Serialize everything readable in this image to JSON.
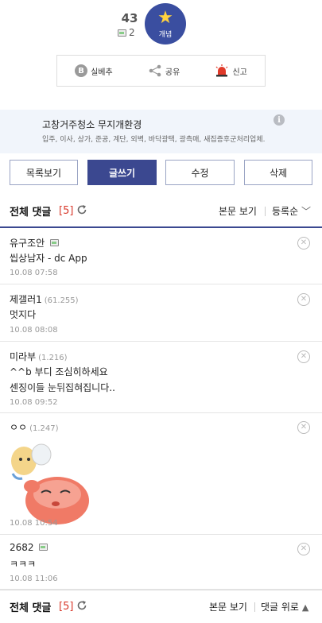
{
  "vote": {
    "up_count": "43",
    "sub_count": "2",
    "up_label": "개념",
    "actions": [
      {
        "label": "실베추",
        "icon": "b-icon"
      },
      {
        "label": "공유",
        "icon": "share-icon"
      },
      {
        "label": "신고",
        "icon": "siren-icon"
      }
    ]
  },
  "ad": {
    "title": "고창거주청소 무지개환경",
    "subtitle": "입주, 이사, 상가, 준공, 계단, 외벽, 바닥광택, 광측매, 새집증후군처리업체.",
    "info_icon": "info-icon"
  },
  "buttons": {
    "list": "목록보기",
    "write": "글쓰기",
    "edit": "수정",
    "delete": "삭제"
  },
  "comments_header": {
    "title": "전체 댓글",
    "count": "[5]",
    "view_body": "본문 보기",
    "sort": "등록순",
    "to_top": "댓글 위로"
  },
  "comments": [
    {
      "nick": "유구조안",
      "ip": "",
      "text": "씹상남자 - dc App",
      "date": "10.08 07:58"
    },
    {
      "nick": "제갤러1",
      "ip": "(61.255)",
      "text": "멋지다",
      "date": "10.08 08:08"
    },
    {
      "nick": "미라부",
      "ip": "(1.216)",
      "text": "^^b 부디 조심히하세요",
      "text2": "센징이들 눈뒤집혀집니다..",
      "date": "10.08 09:52"
    },
    {
      "nick": "ㅇㅇ",
      "ip": "(1.247)",
      "text": "",
      "date": "10.08 10:54"
    },
    {
      "nick": "2682",
      "ip": "",
      "text": "ㅋㅋㅋ",
      "date": "10.08 11:06"
    }
  ],
  "colors": {
    "accent": "#3b4890",
    "count_red": "#d8392b",
    "ad_bg": "#f1f5fb"
  }
}
